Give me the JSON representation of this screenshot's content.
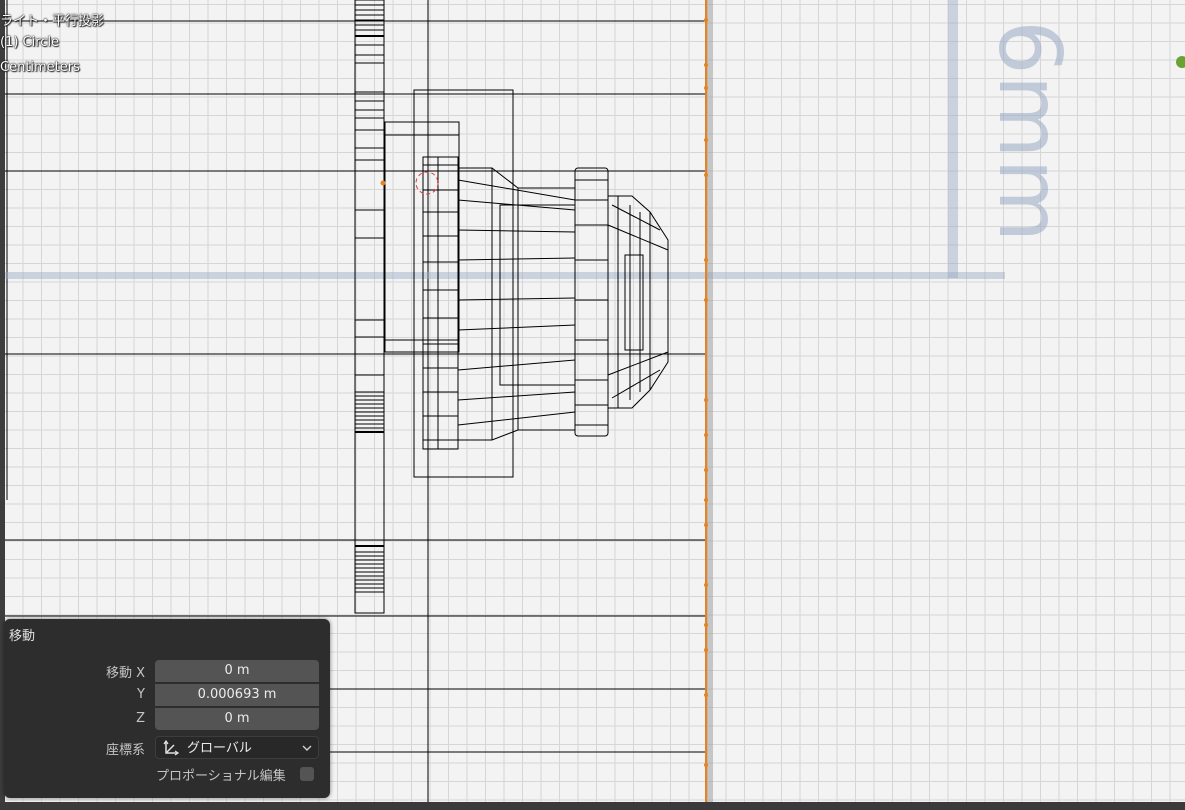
{
  "viewport": {
    "view_name": "ライト・平行投影",
    "object_name": "(1) Circle",
    "units": "Centimeters",
    "ruler_label": "6mm",
    "colors": {
      "grid": "#d6d6d6",
      "wire": "#000000",
      "axis": "#8a9ab4",
      "selection": "#e8821e",
      "green_dot": "#6aa334"
    }
  },
  "operator_panel": {
    "title": "移動",
    "move_x_label": "移動 X",
    "move_x_value": "0 m",
    "y_label": "Y",
    "y_value": "0.000693 m",
    "z_label": "Z",
    "z_value": "0 m",
    "orientation_label": "座標系",
    "orientation_value": "グローバル",
    "proportional_label": "プロポーショナル編集",
    "proportional_checked": false
  }
}
